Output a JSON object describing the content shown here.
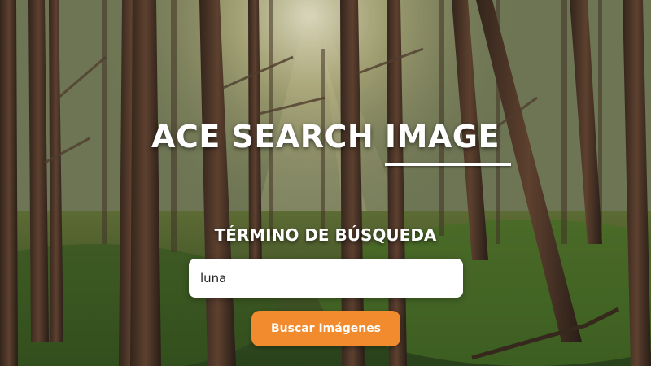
{
  "header": {
    "title": "ACE SEARCH IMAGE"
  },
  "search": {
    "label": "TÉRMINO DE BÚSQUEDA",
    "value": "luna",
    "button_label": "Buscar Imágenes"
  },
  "colors": {
    "button": "#f28a2e",
    "text": "#ffffff",
    "input_bg": "#ffffff"
  },
  "background": {
    "scene": "forest-photo"
  }
}
